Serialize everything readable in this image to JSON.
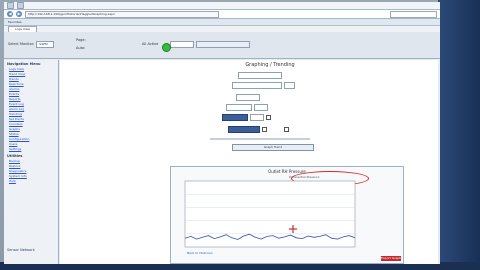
{
  "browser": {
    "url": "http://192.168.1.100/gpmHistorianHaggledGraphing.aspx",
    "favorites_label": "Favorites",
    "tabs": [
      "Logs View"
    ]
  },
  "header": {
    "field_label_1": "Select Monitor:",
    "field_value_1": "GSPM",
    "field_label_2": "Page:",
    "field_label_3": "Auto:",
    "status_label": "All Active"
  },
  "sidebar": {
    "sections": [
      {
        "title": "Navigation Menu",
        "items": [
          "Logs View",
          "Trend View",
          "Trends",
          "Real-Time",
          "Alarms",
          "Events",
          "Reports",
          "Event Log",
          "Alarm Log",
          "Trending",
          "Set Points",
          "Counters",
          "Graphs",
          "Status",
          "Configuration",
          "Users",
          "Settings"
        ]
      },
      {
        "title": "Utilities",
        "items": [
          "Backup",
          "Restore",
          "Diagnostics",
          "System Info",
          "Help"
        ]
      }
    ],
    "footer": "Sensor Network"
  },
  "main": {
    "title": "Graphing / Trending",
    "btn_graph": "Graph Trend"
  },
  "chart": {
    "title": "Outlet RH Pressure",
    "legend_text": "Differential Pressure",
    "red_button": "Export Graph",
    "footer_left": "Back to Historian"
  },
  "chart_data": {
    "type": "line",
    "title": "",
    "xlabel": "",
    "ylabel": "",
    "ylim": [
      0,
      150
    ],
    "series": [
      {
        "values": [
          20,
          24,
          18,
          22,
          26,
          19,
          23,
          28,
          21,
          17,
          25,
          29,
          22,
          18,
          24,
          26,
          20,
          23,
          27,
          21,
          19,
          25,
          22,
          24,
          28,
          20,
          18,
          23,
          26,
          21
        ]
      }
    ]
  }
}
